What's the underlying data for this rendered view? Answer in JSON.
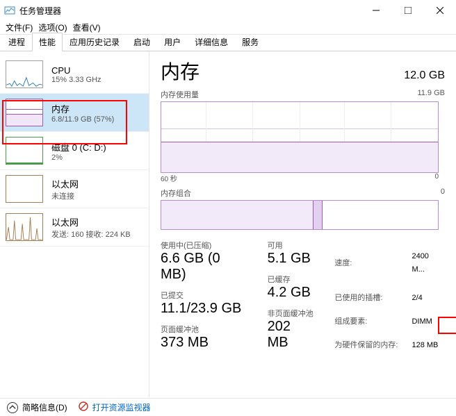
{
  "window": {
    "title": "任务管理器"
  },
  "menu": {
    "file": "文件(F)",
    "options": "选项(O)",
    "view": "查看(V)"
  },
  "tabs": [
    "进程",
    "性能",
    "应用历史记录",
    "启动",
    "用户",
    "详细信息",
    "服务"
  ],
  "sidebar": {
    "items": [
      {
        "name": "CPU",
        "sub": "15% 3.33 GHz"
      },
      {
        "name": "内存",
        "sub": "6.8/11.9 GB (57%)"
      },
      {
        "name": "磁盘 0 (C: D:)",
        "sub": "2%"
      },
      {
        "name": "以太网",
        "sub": "未连接"
      },
      {
        "name": "以太网",
        "sub": "发送: 160 接收: 224 KB"
      }
    ]
  },
  "content": {
    "title": "内存",
    "total": "12.0 GB",
    "usage_label": "内存使用量",
    "usage_max": "11.9 GB",
    "xaxis_left": "60 秒",
    "xaxis_right": "0",
    "comp_label": "内存组合",
    "comp_right": "0",
    "stats": {
      "in_use_label": "使用中(已压缩)",
      "in_use": "6.6 GB (0 MB)",
      "avail_label": "可用",
      "avail": "5.1 GB",
      "commit_label": "已提交",
      "commit": "11.1/23.9 GB",
      "cache_label": "已缓存",
      "cache": "4.2 GB",
      "paged_label": "页面缓冲池",
      "paged": "373 MB",
      "nonpaged_label": "非页面缓冲池",
      "nonpaged": "202 MB"
    },
    "sys": {
      "speed_label": "速度:",
      "speed": "2400 M...",
      "slots_label": "已使用的插槽:",
      "slots": "2/4",
      "form_label": "组成要素:",
      "form": "DIMM",
      "hw_label": "为硬件保留的内存:",
      "hw": "128 MB"
    }
  },
  "footer": {
    "brief": "简略信息(D)",
    "resmon": "打开资源监视器"
  }
}
